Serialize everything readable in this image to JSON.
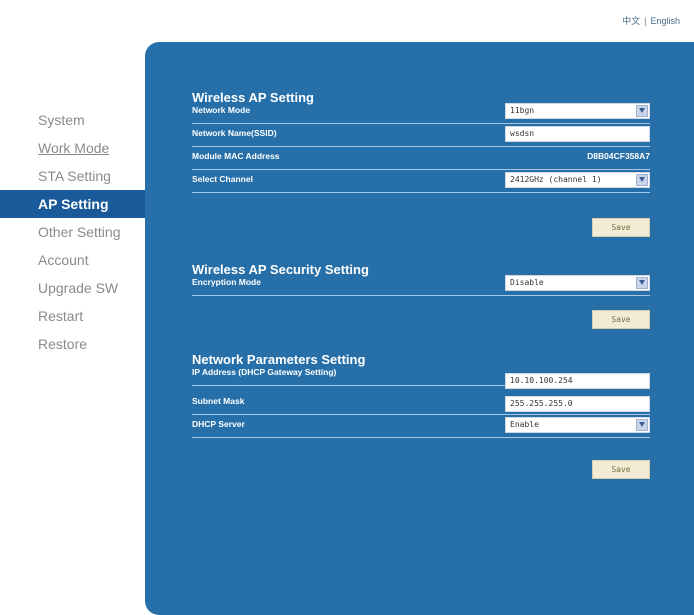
{
  "lang": {
    "chinese": "中文",
    "separator": "|",
    "english": "English"
  },
  "sidebar": {
    "items": [
      {
        "label": "System"
      },
      {
        "label": "Work Mode"
      },
      {
        "label": "STA Setting"
      },
      {
        "label": "AP Setting"
      },
      {
        "label": "Other Setting"
      },
      {
        "label": "Account"
      },
      {
        "label": "Upgrade SW"
      },
      {
        "label": "Restart"
      },
      {
        "label": "Restore"
      }
    ]
  },
  "ap": {
    "title": "Wireless AP Setting",
    "network_mode_label": "Network Mode",
    "network_mode_value": "11bgn",
    "ssid_label": "Network Name(SSID)",
    "ssid_value": "wsdsn",
    "mac_label": "Module MAC Address",
    "mac_value": "D8B04CF358A7",
    "channel_label": "Select Channel",
    "channel_value": "2412GHz (channel 1)",
    "save_label": "Save"
  },
  "security": {
    "title": "Wireless AP Security Setting",
    "encryption_label": "Encryption Mode",
    "encryption_value": "Disable",
    "save_label": "Save"
  },
  "network": {
    "title": "Network Parameters Setting",
    "ip_label": "IP Address (DHCP Gateway Setting)",
    "ip_value": "10.10.100.254",
    "mask_label": "Subnet Mask",
    "mask_value": "255.255.255.0",
    "dhcp_label": "DHCP Server",
    "dhcp_value": "Enable",
    "save_label": "Save"
  },
  "colors": {
    "panel": "#266fa8",
    "active": "#1b5a9a",
    "save": "#f2ecd4"
  }
}
